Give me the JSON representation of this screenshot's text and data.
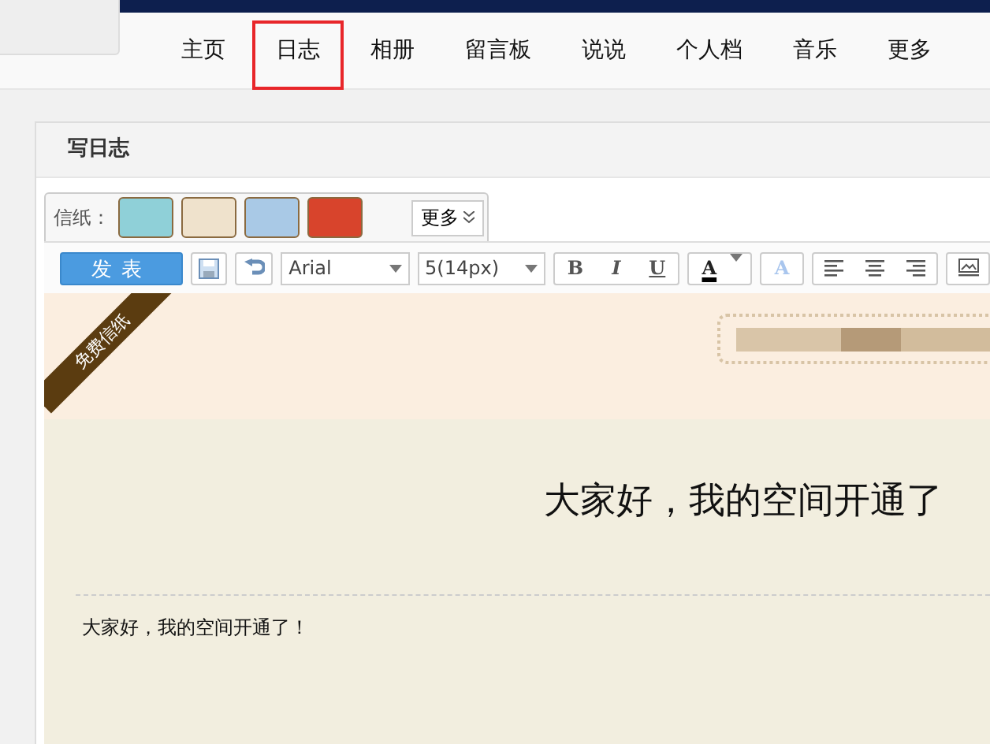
{
  "nav": {
    "items": [
      {
        "label": "主页",
        "selected": false
      },
      {
        "label": "日志",
        "selected": true
      },
      {
        "label": "相册",
        "selected": false
      },
      {
        "label": "留言板",
        "selected": false
      },
      {
        "label": "说说",
        "selected": false
      },
      {
        "label": "个人档",
        "selected": false
      },
      {
        "label": "音乐",
        "selected": false
      },
      {
        "label": "更多",
        "selected": false
      }
    ]
  },
  "panel": {
    "title": "写日志"
  },
  "stationery": {
    "label": "信纸：",
    "more": "更多",
    "ribbon": "免费信纸"
  },
  "toolbar": {
    "publish": "发表",
    "font": "Arial",
    "size": "5(14px)",
    "bold": "B",
    "italic": "I",
    "underline": "U",
    "font_color": "A",
    "text_effect": "A"
  },
  "document": {
    "title": "大家好，我的空间开通了",
    "body": "大家好，我的空间开通了！"
  }
}
